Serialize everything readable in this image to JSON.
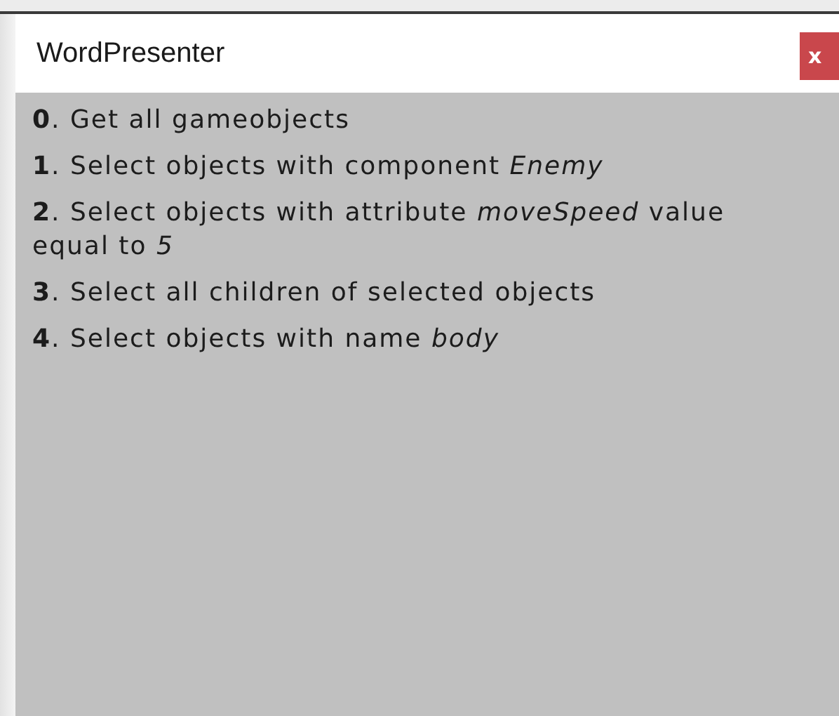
{
  "window": {
    "title": "WordPresenter",
    "close_label": "x"
  },
  "items": [
    "**0**. Get all gameobjects",
    "**1**. Select objects with component *Enemy*",
    "**2**. Select objects with attribute *moveSpeed* value equal to *5*",
    "**3**. Select all children of selected objects",
    "**4**. Select objects with name *body*"
  ]
}
